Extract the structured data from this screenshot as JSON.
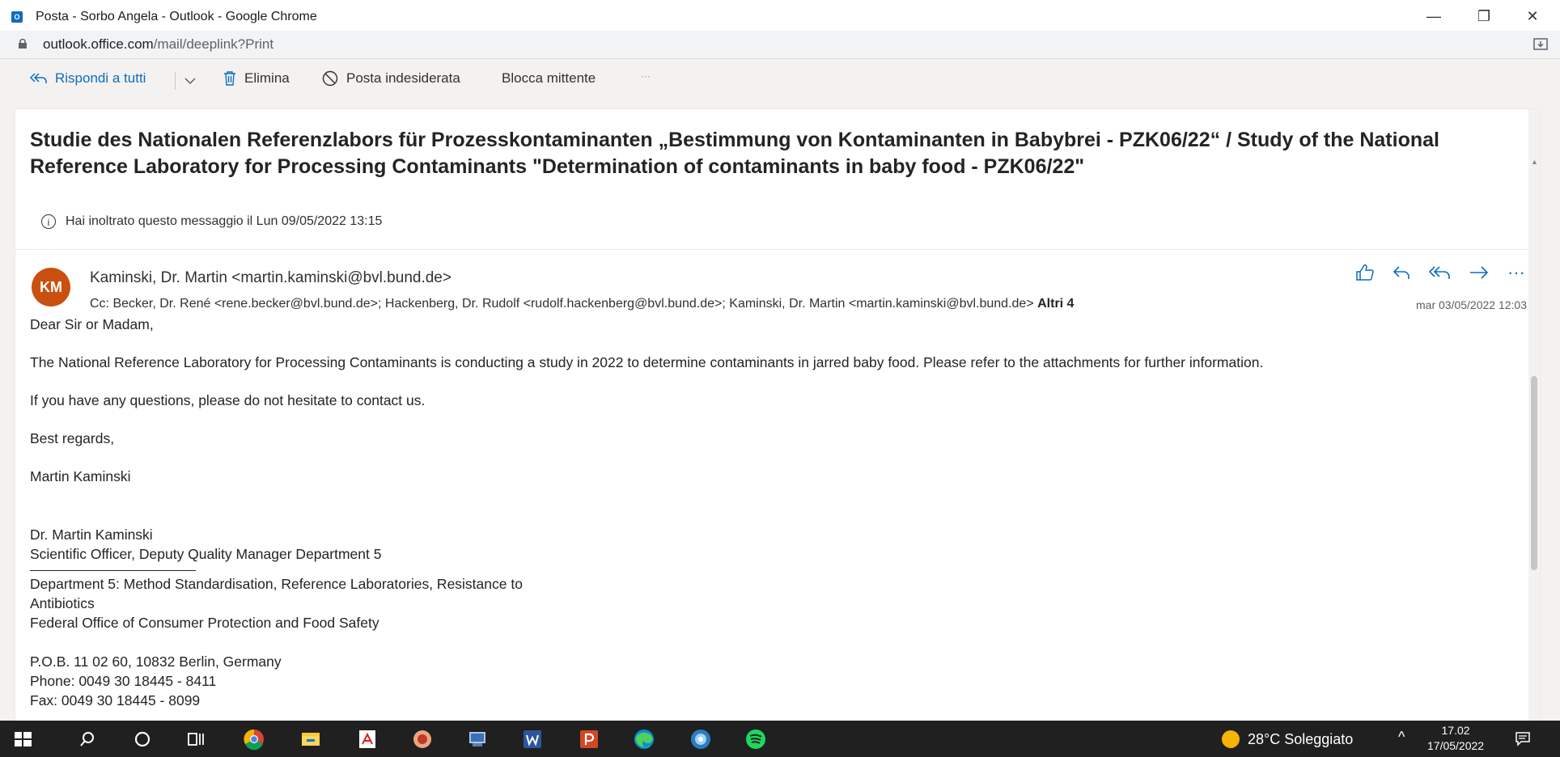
{
  "window": {
    "title": "Posta - Sorbo Angela - Outlook - Google Chrome",
    "minimize": "—",
    "restore": "❐",
    "close": "✕"
  },
  "browser": {
    "url_host": "outlook.office.com",
    "url_path": "/mail/deeplink?Print"
  },
  "toolbar": {
    "reply_all": "Rispondi a tutti",
    "delete": "Elimina",
    "junk": "Posta indesiderata",
    "block": "Blocca mittente",
    "more": "···"
  },
  "message": {
    "subject": "Studie des Nationalen Referenzlabors für Prozesskontaminanten „Bestimmung von Kontaminanten in Babybrei - PZK06/22“ / Study of the National Reference Laboratory for Processing Contaminants \"Determination of contaminants in baby food - PZK06/22\"",
    "forward_info": "Hai inoltrato questo messaggio il Lun 09/05/2022 13:15",
    "avatar_initials": "KM",
    "sender": "Kaminski, Dr. Martin <martin.kaminski@bvl.bund.de>",
    "cc": "Cc:  Becker, Dr. René <rene.becker@bvl.bund.de>;  Hackenberg, Dr. Rudolf <rudolf.hackenberg@bvl.bund.de>;  Kaminski, Dr. Martin <martin.kaminski@bvl.bund.de>",
    "more_recipients": "Altri 4",
    "date": "mar 03/05/2022 12:03",
    "body": {
      "greeting": "Dear Sir or Madam,",
      "para1": "The National Reference Laboratory for Processing Contaminants is conducting a study in 2022 to determine contaminants in jarred baby food. Please refer to the attachments for further information.",
      "para2": "If you have any questions, please do not hesitate to contact us.",
      "closing": "Best regards,",
      "name": "Martin Kaminski",
      "sig_name": "Dr. Martin Kaminski",
      "sig_title": "Scientific Officer, Deputy Quality Manager Department 5",
      "sig_dept1": "Department 5: Method Standardisation, Reference Laboratories, Resistance to",
      "sig_dept2": "Antibiotics",
      "sig_office": "Federal Office of Consumer Protection and Food Safety",
      "sig_address": "P.O.B. 11 02 60, 10832 Berlin, Germany",
      "sig_phone": "Phone: 0049 30 18445 - 8411",
      "sig_fax": "Fax: 0049 30 18445 - 8099"
    }
  },
  "taskbar": {
    "weather": "28°C  Soleggiato",
    "time": "17.02",
    "date": "17/05/2022",
    "caret": "^"
  },
  "colors": {
    "accent": "#0f6cbd",
    "avatar": "#ca5010",
    "taskbar": "#202020"
  }
}
